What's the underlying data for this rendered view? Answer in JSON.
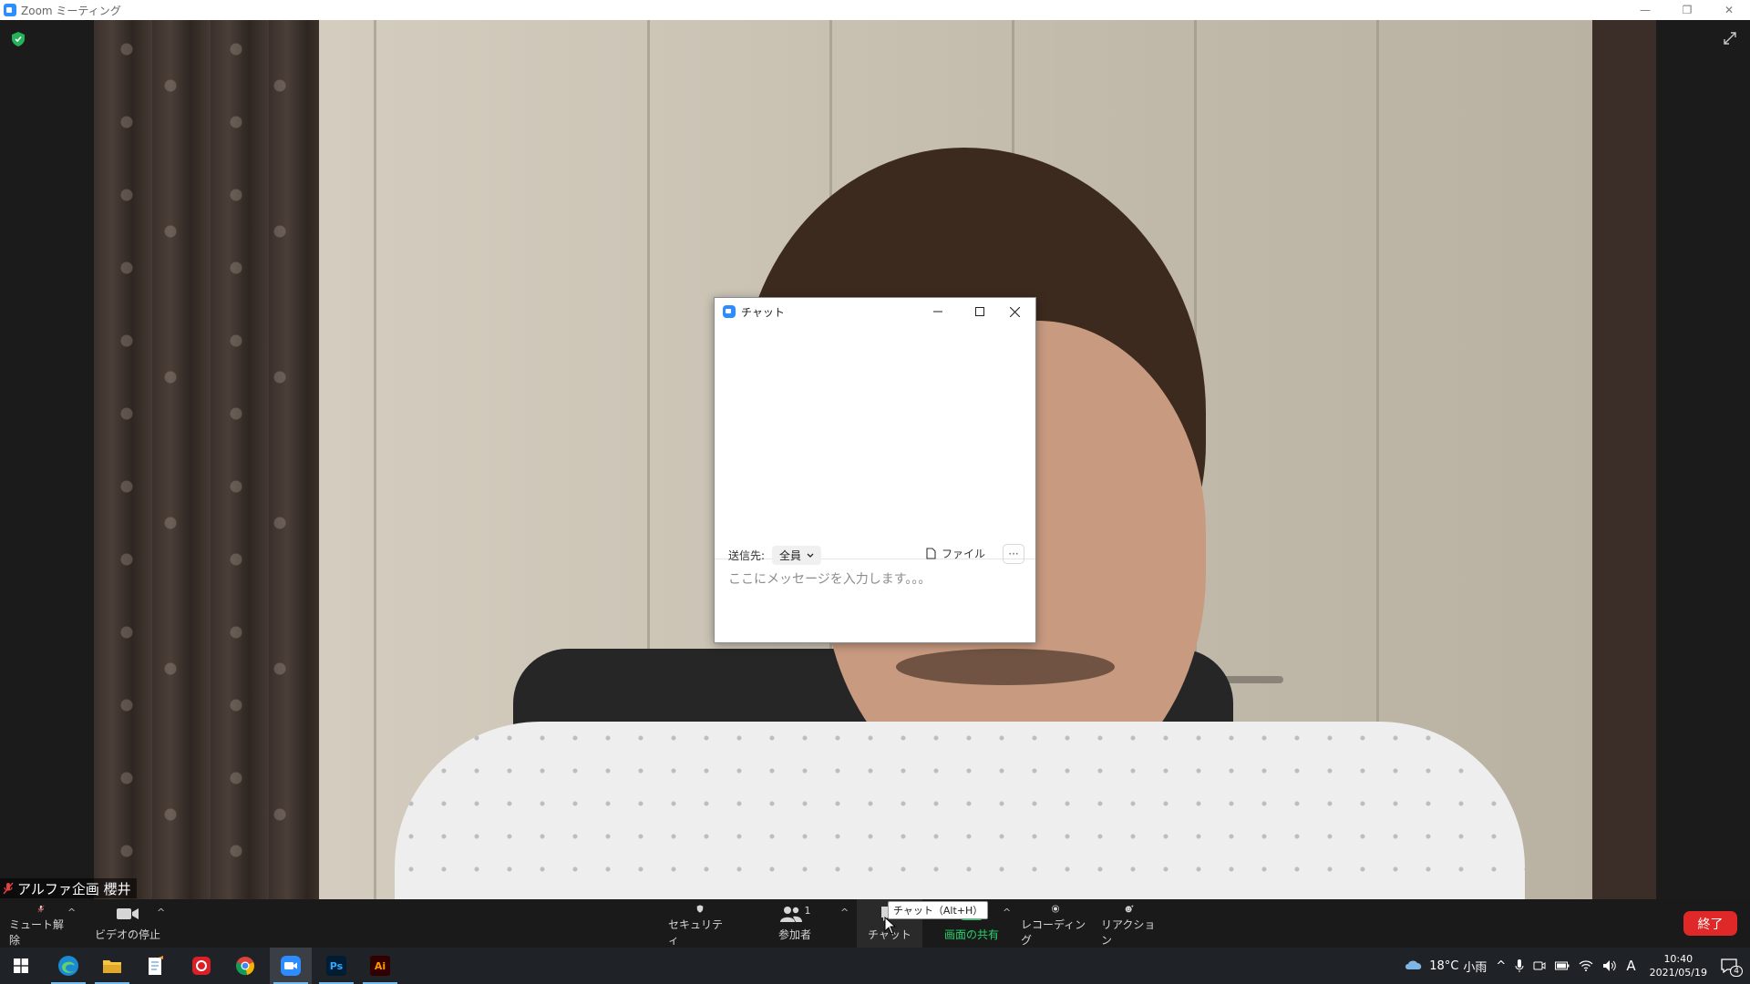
{
  "window": {
    "title": "Zoom ミーティング",
    "controls": [
      "minimize",
      "restore",
      "close"
    ]
  },
  "meeting": {
    "participant_name": "アルファ企画 櫻井"
  },
  "chat_window": {
    "title": "チャット",
    "to_label": "送信先:",
    "to_value": "全員",
    "file_label": "ファイル",
    "more_label": "···",
    "message_placeholder": "ここにメッセージを入力します。。。"
  },
  "toolbar": {
    "mute": "ミュート解除",
    "video": "ビデオの停止",
    "security": "セキュリティ",
    "participants": "参加者",
    "participants_count": "1",
    "chat": "チャット",
    "chat_tooltip": "チャット（Alt+H）",
    "share": "画面の共有",
    "record": "レコーディング",
    "reactions": "リアクション",
    "end": "終了"
  },
  "taskbar": {
    "apps": [
      "start",
      "edge",
      "file-explorer",
      "notepad",
      "creative-cloud",
      "chrome",
      "zoom",
      "photoshop",
      "illustrator"
    ],
    "photoshop_label": "Ps",
    "illustrator_label": "Ai",
    "weather_temp": "18°C",
    "weather_text": "小雨",
    "ime": "A",
    "time": "10:40",
    "date": "2021/05/19",
    "notifications": "4"
  },
  "colors": {
    "zoom_blue": "#2d8cff",
    "share_green": "#24d26b",
    "end_red": "#e02828"
  }
}
